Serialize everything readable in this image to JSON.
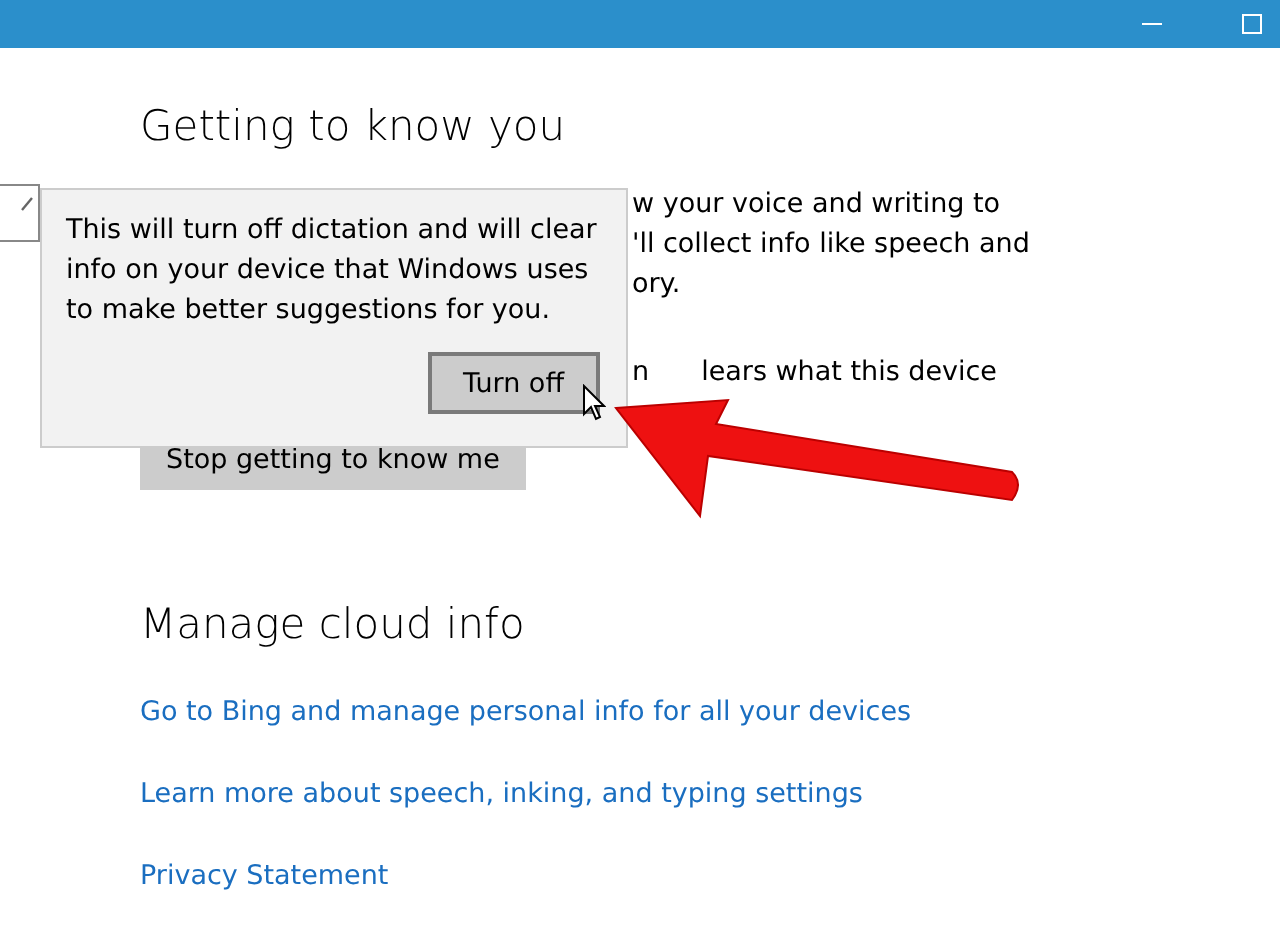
{
  "sections": [
    {
      "heading": "Getting to know you"
    },
    {
      "heading": "Manage cloud info"
    }
  ],
  "description_fragments": [
    {
      "text": "w your voice and writing to"
    },
    {
      "text": "'ll collect info like speech and"
    },
    {
      "text": "ory."
    },
    {
      "text": "n"
    },
    {
      "text": "lears what this device"
    }
  ],
  "stop_button": {
    "label": "Stop getting to know me"
  },
  "links": [
    {
      "label": "Go to Bing and manage personal info for all your devices"
    },
    {
      "label": "Learn more about speech, inking, and typing settings"
    },
    {
      "label": "Privacy Statement"
    }
  ],
  "flyout": {
    "message": "This will turn off dictation and will clear info on your device that Windows uses to make better suggestions for you.",
    "button": {
      "label": "Turn off",
      "hovered": true
    }
  }
}
